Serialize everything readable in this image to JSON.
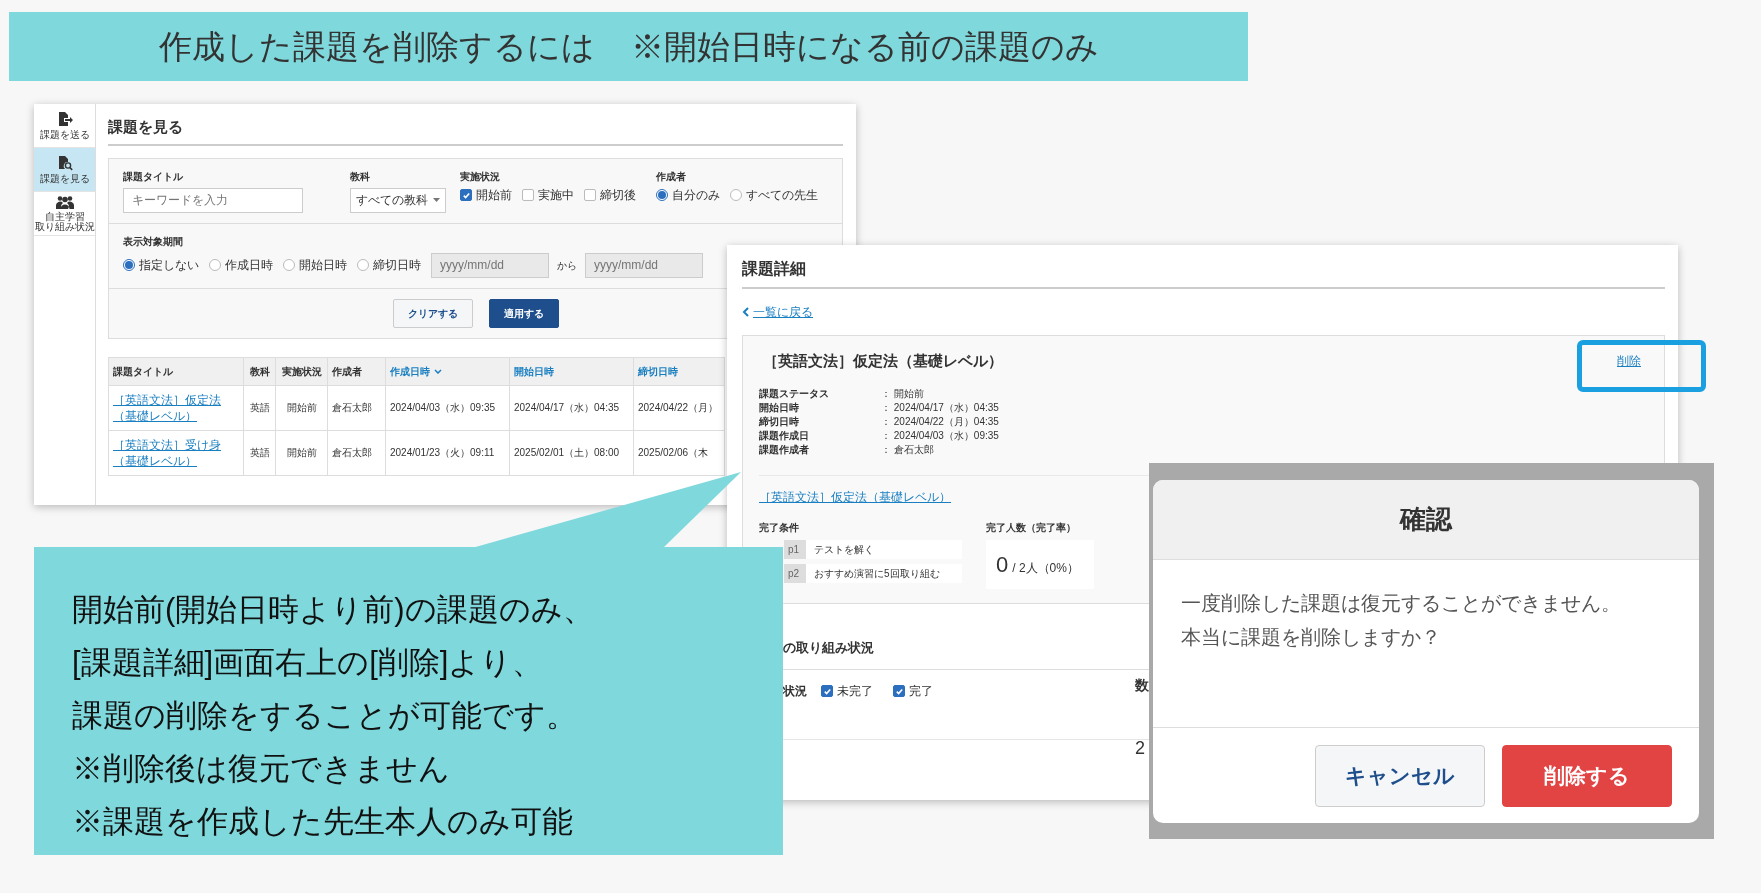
{
  "banner": {
    "title": "作成した課題を削除するには",
    "note": "※開始日時になる前の課題のみ"
  },
  "list_screen": {
    "sidebar": [
      {
        "lines": [
          "課題を送る"
        ],
        "selected": false
      },
      {
        "lines": [
          "課題を見る"
        ],
        "selected": true
      },
      {
        "lines": [
          "自主学習",
          "取り組み状況"
        ],
        "selected": false
      }
    ],
    "heading": "課題を見る",
    "filters": {
      "keyword": {
        "label": "課題タイトル",
        "placeholder": "キーワードを入力"
      },
      "subject": {
        "label": "教科",
        "value": "すべての教科"
      },
      "status": {
        "label": "実施状況",
        "options": [
          {
            "label": "開始前",
            "checked": true
          },
          {
            "label": "実施中",
            "checked": false
          },
          {
            "label": "締切後",
            "checked": false
          }
        ]
      },
      "creator": {
        "label": "作成者",
        "options": [
          {
            "label": "自分のみ",
            "selected": true
          },
          {
            "label": "すべての先生",
            "selected": false
          }
        ]
      },
      "period": {
        "label": "表示対象期間",
        "options": [
          {
            "label": "指定しない",
            "selected": true
          },
          {
            "label": "作成日時",
            "selected": false
          },
          {
            "label": "開始日時",
            "selected": false
          },
          {
            "label": "締切日時",
            "selected": false
          }
        ],
        "from": {
          "placeholder": "yyyy/mm/dd"
        },
        "between": "から",
        "to": {
          "placeholder": "yyyy/mm/dd"
        }
      },
      "buttons": [
        {
          "label": "クリアする",
          "kind": "secondary"
        },
        {
          "label": "適用する",
          "kind": "primary"
        }
      ]
    },
    "table": {
      "columns": [
        {
          "label": "課題タイトル",
          "sortable": false,
          "sorted": false
        },
        {
          "label": "教科",
          "sortable": false,
          "sorted": false
        },
        {
          "label": "実施状況",
          "sortable": false,
          "sorted": false
        },
        {
          "label": "作成者",
          "sortable": false,
          "sorted": false
        },
        {
          "label": "作成日時",
          "sortable": true,
          "sorted": true
        },
        {
          "label": "開始日時",
          "sortable": true,
          "sorted": false
        },
        {
          "label": "締切日時",
          "sortable": true,
          "sorted": false
        }
      ],
      "rows": [
        {
          "cells": [
            "［英語文法］仮定法（基礎レベル）",
            "英語",
            "開始前",
            "倉石太郎",
            "2024/04/03（水）09:35",
            "2024/04/17（水）04:35",
            "2024/04/22（月）"
          ]
        },
        {
          "cells": [
            "［英語文法］受け身（基礎レベル）",
            "英語",
            "開始前",
            "倉石太郎",
            "2024/01/23（火）09:11",
            "2025/02/01（土）08:00",
            "2025/02/06（木"
          ]
        }
      ]
    }
  },
  "detail_screen": {
    "heading": "課題詳細",
    "back_link": "一覧に戻る",
    "card": {
      "title": "［英語文法］仮定法（基礎レベル）",
      "delete_link": "削除",
      "details": [
        {
          "label": "課題ステータス",
          "value": "： 開始前"
        },
        {
          "label": "開始日時",
          "value": "： 2024/04/17（水）04:35"
        },
        {
          "label": "締切日時",
          "value": "： 2024/04/22（月）04:35"
        },
        {
          "label": "課題作成日",
          "value": "： 2024/04/03（水）09:35"
        },
        {
          "label": "課題作成者",
          "value": "： 倉石太郎"
        }
      ],
      "link": "［英語文法］仮定法（基礎レベル）",
      "conditions_label": "完了条件",
      "steps": [
        {
          "step": "p1",
          "text": "テストを解く"
        },
        {
          "step": "p2",
          "text": "おすすめ演習に5回取り組む"
        }
      ],
      "count_label": "完了人数（完了率）",
      "count": "0",
      "count_total": "/ 2人（0%）"
    },
    "section_title": "の取り組み状況",
    "filter_label": "状況",
    "filter_options": [
      {
        "label": "未完了",
        "checked": true
      },
      {
        "label": "完了",
        "checked": true
      }
    ],
    "column_text": "数",
    "cell_text": "2"
  },
  "dialog": {
    "title": "確認",
    "message": [
      "一度削除した課題は復元することができません。",
      "本当に課題を削除しますか？"
    ],
    "buttons": [
      {
        "label": "キャンセル",
        "kind": "secondary"
      },
      {
        "label": "削除する",
        "kind": "danger"
      }
    ]
  },
  "callout": {
    "lines": [
      "開始前(開始日時より前)の課題のみ、",
      "[課題詳細]画面右上の[削除]より、",
      "課題の削除をすることが可能です。",
      "※削除後は復元できません",
      "※課題を作成した先生本人のみ可能"
    ]
  }
}
